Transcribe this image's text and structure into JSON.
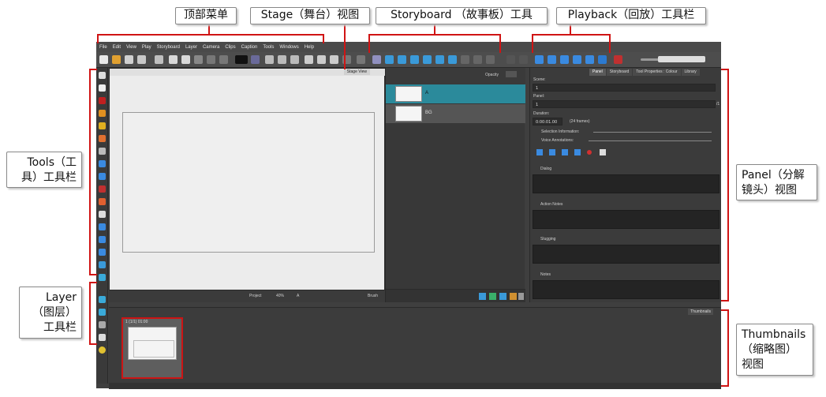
{
  "menubar": {
    "items": [
      "File",
      "Edit",
      "View",
      "Play",
      "Storyboard",
      "Layer",
      "Camera",
      "Clips",
      "Caption",
      "Tools",
      "Windows",
      "Help"
    ]
  },
  "callouts": {
    "top_menu": "顶部菜单",
    "stage": "Stage（舞台）视图",
    "storyboard": "Storyboard （故事板）工具",
    "playback": "Playback（回放）工具栏",
    "tools": [
      "Tools（工",
      "具）工具栏"
    ],
    "layer": [
      "Layer",
      "（图层）",
      "工具栏"
    ],
    "panel": [
      "Panel（分解",
      "镜头）视图"
    ],
    "thumbnails": [
      "Thumbnails",
      "（缩略图）",
      "视图"
    ]
  },
  "stage": {
    "tab": "Stage View",
    "opacity_label": "Opacity",
    "bottom_project": "Project",
    "bottom_zoom": "40%",
    "bottom_a": "A",
    "bottom_brush": "Brush"
  },
  "layers": {
    "rows": [
      {
        "name": "A"
      },
      {
        "name": "BG"
      }
    ]
  },
  "panel": {
    "tabs": [
      "Panel",
      "Storyboard",
      "Tool Properties : Colour",
      "Library"
    ],
    "scene_label": "Scene:",
    "scene_value": "1",
    "panel_label": "Panel:",
    "panel_value": "1",
    "panel_of": "/1",
    "duration_label": "Duration:",
    "duration_value": "0:00:01.00",
    "duration_frames": "(24 frames)",
    "selection_info": "Selection Information:",
    "voice_annotations": "Voice Annotations:",
    "sections": [
      "Dialog",
      "Action Notes",
      "Slugging",
      "Notes"
    ]
  },
  "thumbnails": {
    "tab": "Thumbnails",
    "card_caption": "1 (1/1) 01:00"
  },
  "colors": {
    "callout_red": "#d01414",
    "layer_selected": "#2b8a9b"
  }
}
